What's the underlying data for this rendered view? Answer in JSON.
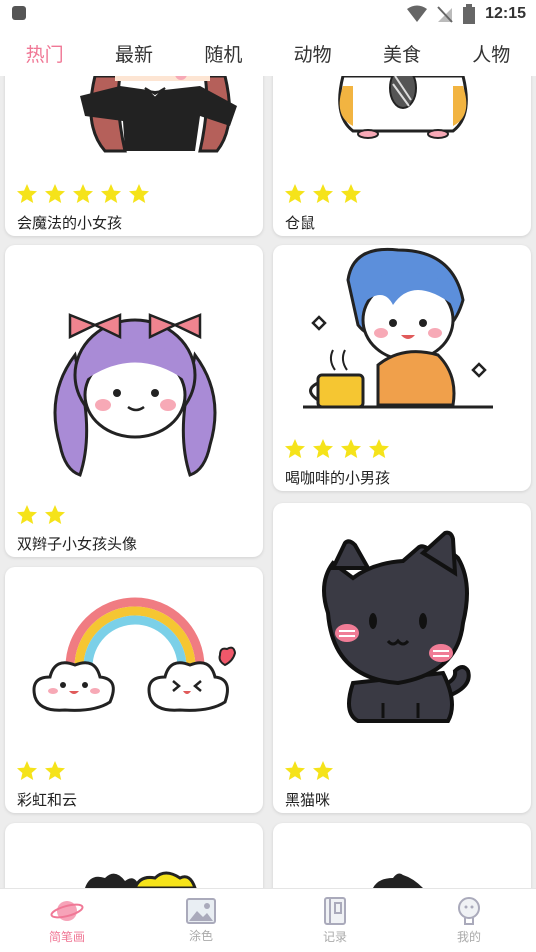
{
  "status": {
    "time": "12:15"
  },
  "tabs": [
    {
      "label": "热门",
      "active": true
    },
    {
      "label": "最新",
      "active": false
    },
    {
      "label": "随机",
      "active": false
    },
    {
      "label": "动物",
      "active": false
    },
    {
      "label": "美食",
      "active": false
    },
    {
      "label": "人物",
      "active": false
    }
  ],
  "cards": [
    {
      "title": "会魔法的小女孩",
      "stars": 5
    },
    {
      "title": "仓鼠",
      "stars": 3
    },
    {
      "title": "双辫子小女孩头像",
      "stars": 2
    },
    {
      "title": "喝咖啡的小男孩",
      "stars": 4
    },
    {
      "title": "彩虹和云",
      "stars": 2
    },
    {
      "title": "黑猫咪",
      "stars": 2
    }
  ],
  "bottom_nav": [
    {
      "label": "简笔画",
      "icon": "planet-icon",
      "active": true
    },
    {
      "label": "涂色",
      "icon": "image-icon",
      "active": false
    },
    {
      "label": "记录",
      "icon": "notebook-icon",
      "active": false
    },
    {
      "label": "我的",
      "icon": "profile-icon",
      "active": false
    }
  ],
  "colors": {
    "accent": "#f07896",
    "star": "#f5e31a"
  }
}
